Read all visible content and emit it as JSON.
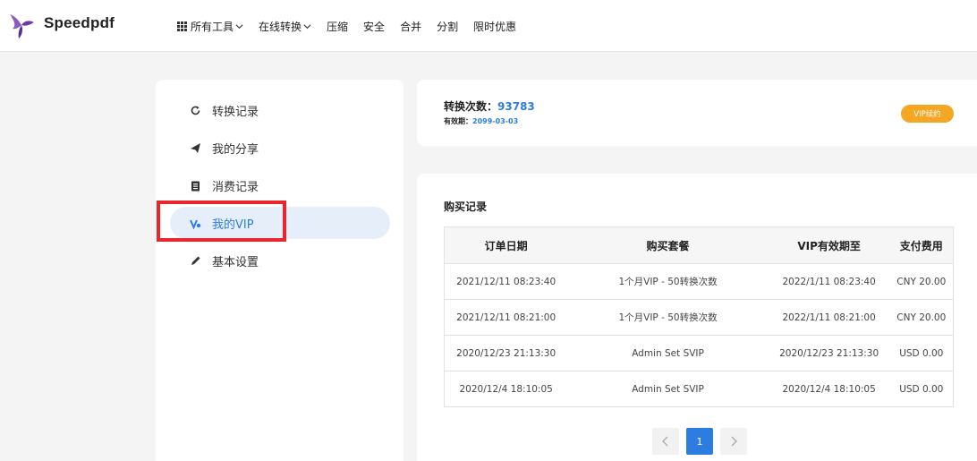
{
  "header": {
    "brand": "Speedpdf",
    "nav": [
      {
        "label": "所有工具",
        "dropdown": true,
        "icon": "grid-icon"
      },
      {
        "label": "在线转换",
        "dropdown": true
      },
      {
        "label": "压缩"
      },
      {
        "label": "安全"
      },
      {
        "label": "合并"
      },
      {
        "label": "分割"
      },
      {
        "label": "限时优惠"
      }
    ]
  },
  "sidebar": {
    "items": [
      {
        "label": "转换记录",
        "icon": "refresh-icon"
      },
      {
        "label": "我的分享",
        "icon": "send-icon"
      },
      {
        "label": "消费记录",
        "icon": "clipboard-icon"
      },
      {
        "label": "我的VIP",
        "icon": "vip-icon",
        "active": true
      },
      {
        "label": "基本设置",
        "icon": "pencil-icon"
      }
    ]
  },
  "stats": {
    "count_label": "转换次数：",
    "count_value": "93783",
    "expire_label": "有效期：",
    "expire_value": "2099-03-03",
    "vip_button": "VIP续约"
  },
  "orders": {
    "title": "购买记录",
    "columns": [
      "订单日期",
      "购买套餐",
      "VIP有效期至",
      "支付费用"
    ],
    "rows": [
      [
        "2021/12/11 08:23:40",
        "1个月VIP - 50转换次数",
        "2022/1/11 08:23:40",
        "CNY 20.00"
      ],
      [
        "2021/12/11 08:21:00",
        "1个月VIP - 50转换次数",
        "2022/1/11 08:21:00",
        "CNY 20.00"
      ],
      [
        "2020/12/23 21:13:30",
        "Admin Set SVIP",
        "2020/12/23 21:13:30",
        "USD 0.00"
      ],
      [
        "2020/12/4 18:10:05",
        "Admin Set SVIP",
        "2020/12/4 18:10:05",
        "USD 0.00"
      ]
    ]
  },
  "pagination": {
    "current_page": "1"
  },
  "colors": {
    "accent": "#2d7de0",
    "vip_button": "#f5a623",
    "highlight_box": "#e8262c"
  }
}
